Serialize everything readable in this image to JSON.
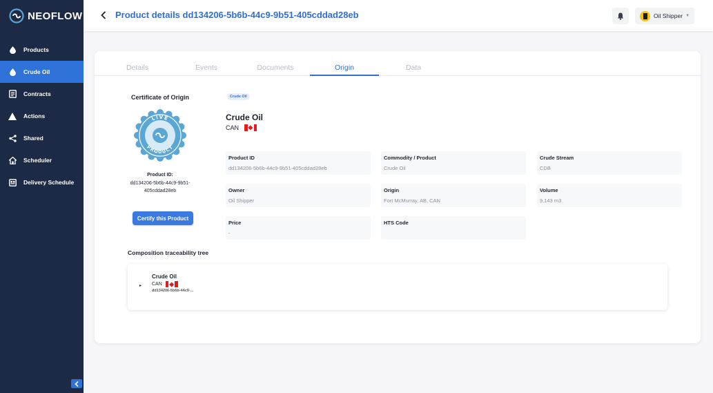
{
  "brand": {
    "name": "NEOFLOW"
  },
  "sidebar": {
    "items": [
      {
        "label": "Products",
        "icon": "drop-icon",
        "active": false
      },
      {
        "label": "Crude Oil",
        "icon": "drop-icon",
        "active": true
      },
      {
        "label": "Contracts",
        "icon": "document-icon",
        "active": false
      },
      {
        "label": "Actions",
        "icon": "warning-icon",
        "active": false
      },
      {
        "label": "Shared",
        "icon": "share-icon",
        "active": false
      },
      {
        "label": "Scheduler",
        "icon": "home-icon",
        "active": false
      },
      {
        "label": "Delivery Schedule",
        "icon": "calendar-icon",
        "active": false
      }
    ]
  },
  "header": {
    "title": "Product details dd134206-5b6b-44c9-9b51-405cddad28eb",
    "user": "Oil Shipper"
  },
  "tabs": [
    {
      "label": "Details",
      "active": false
    },
    {
      "label": "Events",
      "active": false
    },
    {
      "label": "Documents",
      "active": false
    },
    {
      "label": "Origin",
      "active": true
    },
    {
      "label": "Data",
      "active": false
    }
  ],
  "certificate": {
    "title": "Certificate of Origin",
    "seal_top": "LIVE",
    "seal_bottom": "PRODUCT",
    "product_id_label": "Product ID:",
    "product_id_line1": "dd134206-5b6b-44c9-9b51-",
    "product_id_line2": "405cddad28eb",
    "button": "Certify this Product"
  },
  "product": {
    "tag": "Crude Oil",
    "name": "Crude Oil",
    "country": "CAN",
    "fields": [
      {
        "label": "Product ID",
        "value": "dd134206-5b6b-44c9-9b51-405cddad28eb"
      },
      {
        "label": "Commodity / Product",
        "value": "Crude Oil"
      },
      {
        "label": "Crude Stream",
        "value": "CDB"
      },
      {
        "label": "Owner",
        "value": "Oil Shipper"
      },
      {
        "label": "Origin",
        "value": "Fort McMurray, AB, CAN"
      },
      {
        "label": "Volume",
        "value": "9,143 m3"
      },
      {
        "label": "Price",
        "value": "-"
      },
      {
        "label": "HTS Code",
        "value": ""
      }
    ]
  },
  "tree": {
    "title": "Composition traceability tree",
    "toggle": "▸",
    "node_name": "Crude Oil",
    "node_country": "CAN",
    "node_id": "dd134206-5b6b-44c9-..."
  },
  "colors": {
    "sidebar_bg": "#1d2a45",
    "accent": "#2f72d8",
    "flag_red": "#e21c1c",
    "seal_blue": "#5aa6d4"
  }
}
